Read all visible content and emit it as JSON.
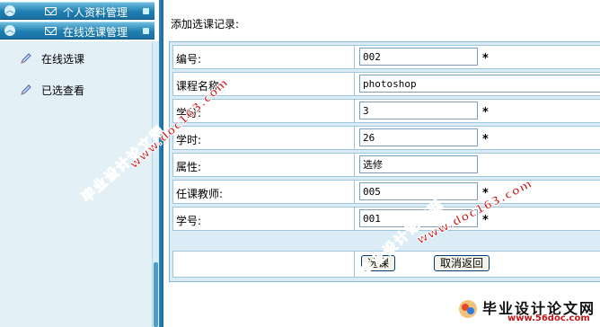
{
  "sidebar": {
    "headers": [
      {
        "label": "个人资料管理"
      },
      {
        "label": "在线选课管理"
      }
    ],
    "items": [
      {
        "label": "在线选课"
      },
      {
        "label": "已选查看"
      }
    ]
  },
  "form": {
    "title": "添加选课记录:",
    "fields": [
      {
        "label": "编号:",
        "value": "002",
        "required": true
      },
      {
        "label": "课程名称:",
        "value": "photoshop",
        "required": false
      },
      {
        "label": "学分:",
        "value": "3",
        "required": true
      },
      {
        "label": "学时:",
        "value": "26",
        "required": true
      },
      {
        "label": "属性:",
        "value": "选修",
        "required": false
      },
      {
        "label": "任课教师:",
        "value": "005",
        "required": true
      },
      {
        "label": "学号:",
        "value": "001",
        "required": true
      }
    ],
    "required_mark": "*",
    "submit_label": "选课",
    "cancel_label": "取消返回"
  },
  "watermarks": {
    "cn_text": "毕业设计论文网",
    "url_text": "www.doc163.com",
    "logo_name": "毕业设计论文网",
    "logo_url": "www.56doc.com"
  },
  "colors": {
    "header_blue": "#1f7fb2",
    "menu_bg": "#e3f1f7",
    "panel_bg": "#dcecf6",
    "watermark_red": "#cc1111"
  }
}
